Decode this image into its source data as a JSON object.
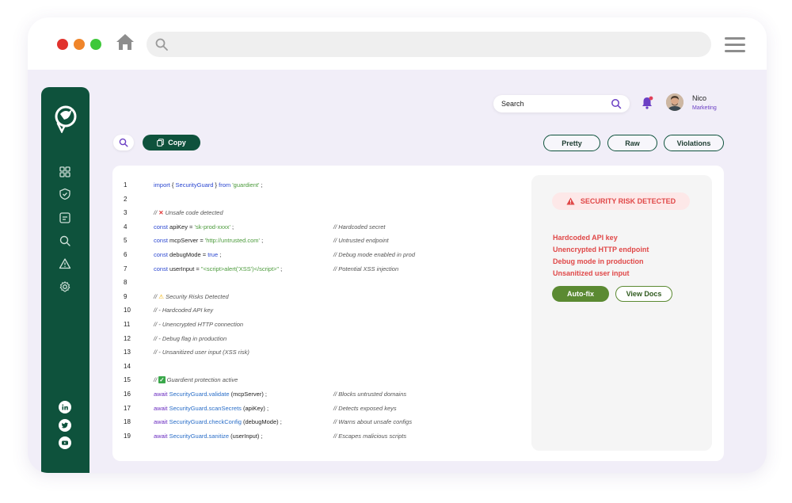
{
  "browser": {
    "url_value": "",
    "icons": [
      "home-icon",
      "search-icon",
      "menu-icon"
    ]
  },
  "sidebar": {
    "items": [
      "dashboard-icon",
      "shield-icon",
      "terminal-icon",
      "search-icon",
      "warning-icon",
      "settings-icon"
    ],
    "social": [
      "linkedin-icon",
      "twitter-icon",
      "youtube-icon"
    ]
  },
  "header": {
    "search_placeholder": "Search",
    "user": {
      "name": "Nico",
      "role": "Marketing"
    }
  },
  "toolbar": {
    "copy_label": "Copy",
    "tabs": [
      "Pretty",
      "Raw",
      "Violations"
    ]
  },
  "code": {
    "lines": [
      {
        "n": "1",
        "html": "<span class='kw'>import</span> { <span class='kw'>SecurityGuard</span> } <span class='kw'>from</span> <span class='str'>'guardient'</span> ;",
        "comment": ""
      },
      {
        "n": "2",
        "html": "",
        "comment": ""
      },
      {
        "n": "3",
        "html": "<span class='comment'>// <span style='color:#e03030;font-style:normal;font-weight:bold;'>✕</span> Unsafe code detected</span>",
        "comment": ""
      },
      {
        "n": "4",
        "html": "<span class='kw'>const</span> apiKey = <span class='str'>'sk-prod-xxxx'</span> ;",
        "comment": "// Hardcoded secret"
      },
      {
        "n": "5",
        "html": "<span class='kw'>const</span> mcpServer = <span class='str'>'http://untrusted.com'</span> ;",
        "comment": "// Untrusted endpoint"
      },
      {
        "n": "6",
        "html": "<span class='kw'>const</span> debugMode = <span class='kw'>true</span> ;",
        "comment": "// Debug mode enabled in prod"
      },
      {
        "n": "7",
        "html": "<span class='kw'>const</span> userInput = <span class='str'>\"&lt;script&gt;alert('XSS')&lt;/script&gt;\"</span> ;",
        "comment": "// Potential XSS injection"
      },
      {
        "n": "8",
        "html": "",
        "comment": ""
      },
      {
        "n": "9",
        "html": "<span class='comment'>// <span style='color:#f0b000;font-style:normal;'>⚠</span> Security Risks Detected</span>",
        "comment": ""
      },
      {
        "n": "10",
        "html": "<span class='comment'>// - Hardcoded API key</span>",
        "comment": ""
      },
      {
        "n": "11",
        "html": "<span class='comment'>// - Unencrypted HTTP connection</span>",
        "comment": ""
      },
      {
        "n": "12",
        "html": "<span class='comment'>// - Debug flag in production</span>",
        "comment": ""
      },
      {
        "n": "13",
        "html": "<span class='comment'>// - Unsanitized user input (XSS risk)</span>",
        "comment": ""
      },
      {
        "n": "14",
        "html": "",
        "comment": ""
      },
      {
        "n": "15",
        "html": "<span class='comment'>// <span style='background:#3aa84a;color:#fff;font-style:normal;font-weight:bold;padding:0 1px;border-radius:1px;'>✓</span> Guardient protection active</span>",
        "comment": ""
      },
      {
        "n": "16",
        "html": "<span class='aw'>await</span> <span class='fn'>SecurityGuard</span>.<span class='fn'>validate</span> (mcpServer) ;",
        "comment": "// Blocks untrusted domains"
      },
      {
        "n": "17",
        "html": "<span class='aw'>await</span> <span class='fn'>SecurityGuard</span>.<span class='fn'>scanSecrets</span> (apiKey) ;",
        "comment": "// Detects exposed keys"
      },
      {
        "n": "18",
        "html": "<span class='aw'>await</span> <span class='fn'>SecurityGuard</span>.<span class='fn'>checkConfig</span> (debugMode) ;",
        "comment": "// Warns about unsafe configs"
      },
      {
        "n": "19",
        "html": "<span class='aw'>await</span> <span class='fn'>SecurityGuard</span>.<span class='fn'>sanitize</span> (userInput) ;",
        "comment": "// Escapes malicious scripts"
      }
    ]
  },
  "risk_panel": {
    "badge": "SECURITY RISK DETECTED",
    "items": [
      "Hardcoded API key",
      "Unencrypted HTTP endpoint",
      "Debug mode in production",
      "Unsanitized user input"
    ],
    "autofix_label": "Auto-fix",
    "docs_label": "View Docs"
  },
  "colors": {
    "brand_green": "#0e523c",
    "accent_purple": "#6b3fc4",
    "danger_red": "#e04848",
    "action_green": "#5b8a32"
  }
}
